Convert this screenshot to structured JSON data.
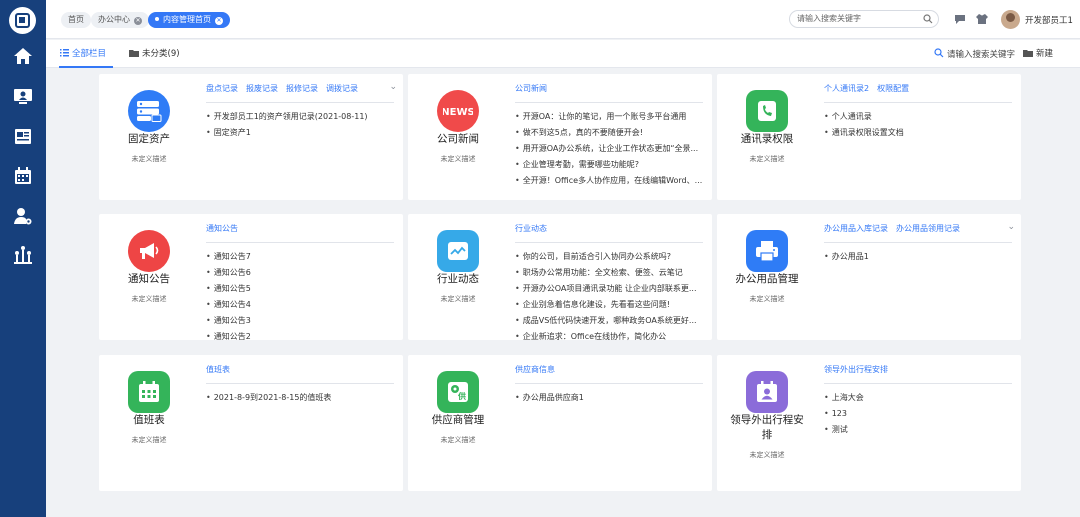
{
  "topbar": {
    "crumbs": [
      "首页",
      "办公中心",
      "内容管理首页"
    ],
    "search_placeholder": "请输入搜索关键字",
    "user_name": "开发部员工1"
  },
  "subbar": {
    "tab_all": "全部栏目",
    "tab_uncat": "未分类(9)",
    "search_placeholder": "请输入搜索关键字",
    "new_label": "新建"
  },
  "colors": {
    "sidebar": "#17407c",
    "accent": "#3478f6"
  },
  "cards": [
    {
      "title": "固定资产",
      "desc": "未定义描述",
      "icon": "server-icon",
      "color": "#2f7cf6",
      "links": [
        "盘点记录",
        "报废记录",
        "报修记录",
        "调拨记录"
      ],
      "has_chevron": true,
      "items": [
        "开发部员工1的资产领用记录(2021-08-11)",
        "固定资产1"
      ]
    },
    {
      "title": "公司新闻",
      "desc": "未定义描述",
      "icon": "news-icon",
      "color": "#f04a4a",
      "links": [
        "公司新闻"
      ],
      "has_chevron": false,
      "items": [
        "开源OA：让你的笔记，用一个账号多平台通用",
        "做不到这5点，真的不要随便开会!",
        "用开源OA办公系统，让企业工作状态更加“全景...",
        "企业管理考勤，需要哪些功能呢?",
        "全开源！Office多人协作应用，在线编辑Word、..."
      ]
    },
    {
      "title": "通讯录权限",
      "desc": "未定义描述",
      "icon": "phone-icon",
      "color": "#34b45a",
      "links": [
        "个人通讯录2",
        "权限配置"
      ],
      "has_chevron": false,
      "items": [
        "个人通讯录",
        "通讯录权限设置文档"
      ]
    },
    {
      "title": "通知公告",
      "desc": "未定义描述",
      "icon": "megaphone-icon",
      "color": "#ee4545",
      "links": [
        "通知公告"
      ],
      "has_chevron": false,
      "items": [
        "通知公告7",
        "通知公告6",
        "通知公告5",
        "通知公告4",
        "通知公告3",
        "通知公告2"
      ]
    },
    {
      "title": "行业动态",
      "desc": "未定义描述",
      "icon": "trend-icon",
      "color": "#36a9e8",
      "links": [
        "行业动态"
      ],
      "has_chevron": false,
      "items": [
        "你的公司，目前适合引入协同办公系统吗?",
        "职场办公常用功能：全文检索、便签、云笔记",
        "开源办公OA项目通讯录功能 让企业内部联系更...",
        "企业别急着信息化建设，先看看这些问题!",
        "成品VS低代码快速开发，哪种政务OA系统更好...",
        "企业新追求：Office在线协作，简化办公"
      ]
    },
    {
      "title": "办公用品管理",
      "desc": "未定义描述",
      "icon": "printer-icon",
      "color": "#2f7cf6",
      "links": [
        "办公用品入库记录",
        "办公用品领用记录"
      ],
      "has_chevron": true,
      "items": [
        "办公用品1"
      ]
    },
    {
      "title": "值班表",
      "desc": "未定义描述",
      "icon": "calendar-icon",
      "color": "#34b45a",
      "links": [
        "值班表"
      ],
      "has_chevron": false,
      "items": [
        "2021-8-9到2021-8-15的值班表"
      ]
    },
    {
      "title": "供应商管理",
      "desc": "未定义描述",
      "icon": "supplier-icon",
      "color": "#34b45a",
      "links": [
        "供应商信息"
      ],
      "has_chevron": false,
      "items": [
        "办公用品供应商1"
      ]
    },
    {
      "title": "领导外出行程安排",
      "desc": "未定义描述",
      "icon": "schedule-icon",
      "color": "#8b6cd9",
      "links": [
        "领导外出行程安排"
      ],
      "has_chevron": false,
      "items": [
        "上海大会",
        "123",
        "测试"
      ]
    }
  ]
}
